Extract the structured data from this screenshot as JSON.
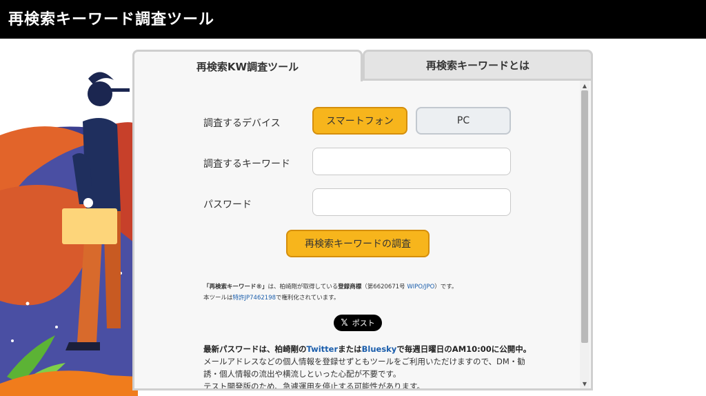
{
  "header": {
    "title": "再検索キーワード調査ツール"
  },
  "tabs": [
    {
      "label": "再検索KW調査ツール",
      "active": true
    },
    {
      "label": "再検索キーワードとは",
      "active": false
    }
  ],
  "form": {
    "device_label": "調査するデバイス",
    "device_options": [
      "スマートフォン",
      "PC"
    ],
    "device_selected": "スマートフォン",
    "keyword_label": "調査するキーワード",
    "keyword_value": "",
    "password_label": "パスワード",
    "password_value": "",
    "submit_label": "再検索キーワードの調査"
  },
  "notice": {
    "trademark_quote": "「再検索キーワード®」",
    "trademark_mid": "は、柏崎剛が取得している",
    "trademark_reg": "登録商標",
    "trademark_num": "（第6620671号 ",
    "trademark_link": "WIPO/JPO",
    "trademark_end": "）です。",
    "patent_pre": "本ツールは",
    "patent_link": "特許JP7462198",
    "patent_post": "で権利化されています。"
  },
  "share": {
    "label": "ポスト",
    "icon": "x-logo-icon"
  },
  "info": {
    "pw_pre": "最新パスワードは、柏崎剛の",
    "pw_twitter": "Twitter",
    "pw_mid": "または",
    "pw_bluesky": "Bluesky",
    "pw_post": "で毎週日曜日のAM10:00に公開中。",
    "line2": "メールアドレスなどの個人情報を登録せずともツールをご利用いただけますので、DM・勧",
    "line3": "誘・個人情報の流出や横流しといった心配が不要です。",
    "line4": "テスト開発版のため、急遽運用を停止する可能性があります。"
  },
  "colors": {
    "accent": "#f7b51c",
    "accent_border": "#d48e0c",
    "link": "#1a5dab",
    "header_bg": "#000000"
  }
}
